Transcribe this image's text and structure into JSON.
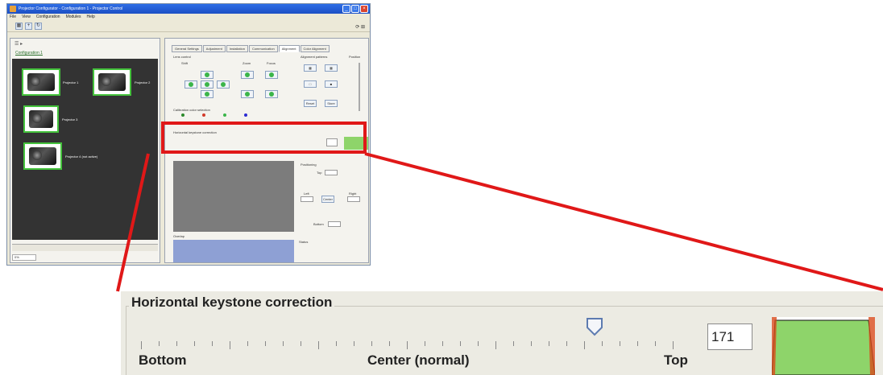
{
  "window": {
    "title": "Projector Configurator - Configuration 1 - Projector Control",
    "menu": [
      "File",
      "View",
      "Configuration",
      "Modules",
      "Help"
    ],
    "toolbar_right": "⟳ ⊞"
  },
  "left_pane": {
    "tab_label": "Configuration 1",
    "footer": "0%",
    "projectors": [
      {
        "label": "Projector 1"
      },
      {
        "label": "Projector 2"
      },
      {
        "label": "Projector 3"
      },
      {
        "label": "Projector 4 (not active)"
      }
    ]
  },
  "right_pane": {
    "tabs": [
      "General Settings",
      "Adjustment",
      "Installation",
      "Communication",
      "Alignment",
      "Color Alignment"
    ],
    "active_tab_index": 4,
    "sections": {
      "lens_control": "Lens control",
      "shift": "Shift",
      "zoom": "Zoom",
      "focus": "Focus",
      "alignment_patterns": "Alignment patterns",
      "position": "Position",
      "calibration_color": "Calibration color selection",
      "keystone_small": "Horizontal keystone correction",
      "positioning": "Positioning",
      "overlap": "Overlap",
      "status": "Status"
    },
    "buttons": {
      "reset": "Reset",
      "store": "Store",
      "center": "Center"
    },
    "position_fields": {
      "top": "Top",
      "left": "Left",
      "right": "Right",
      "bottom": "Bottom"
    },
    "calibration_colors": [
      "#2c8a2c",
      "#d23a2a",
      "#3bb54a",
      "#2a2ad2"
    ]
  },
  "zoom_panel": {
    "title": "Horizontal keystone correction",
    "label_bottom": "Bottom",
    "label_center": "Center (normal)",
    "label_top": "Top",
    "value": "171",
    "slider_fraction": 0.853,
    "preview_fill": "#8ed46a"
  },
  "colors": {
    "highlight": "#e01818",
    "status_green": "#44c23c"
  }
}
